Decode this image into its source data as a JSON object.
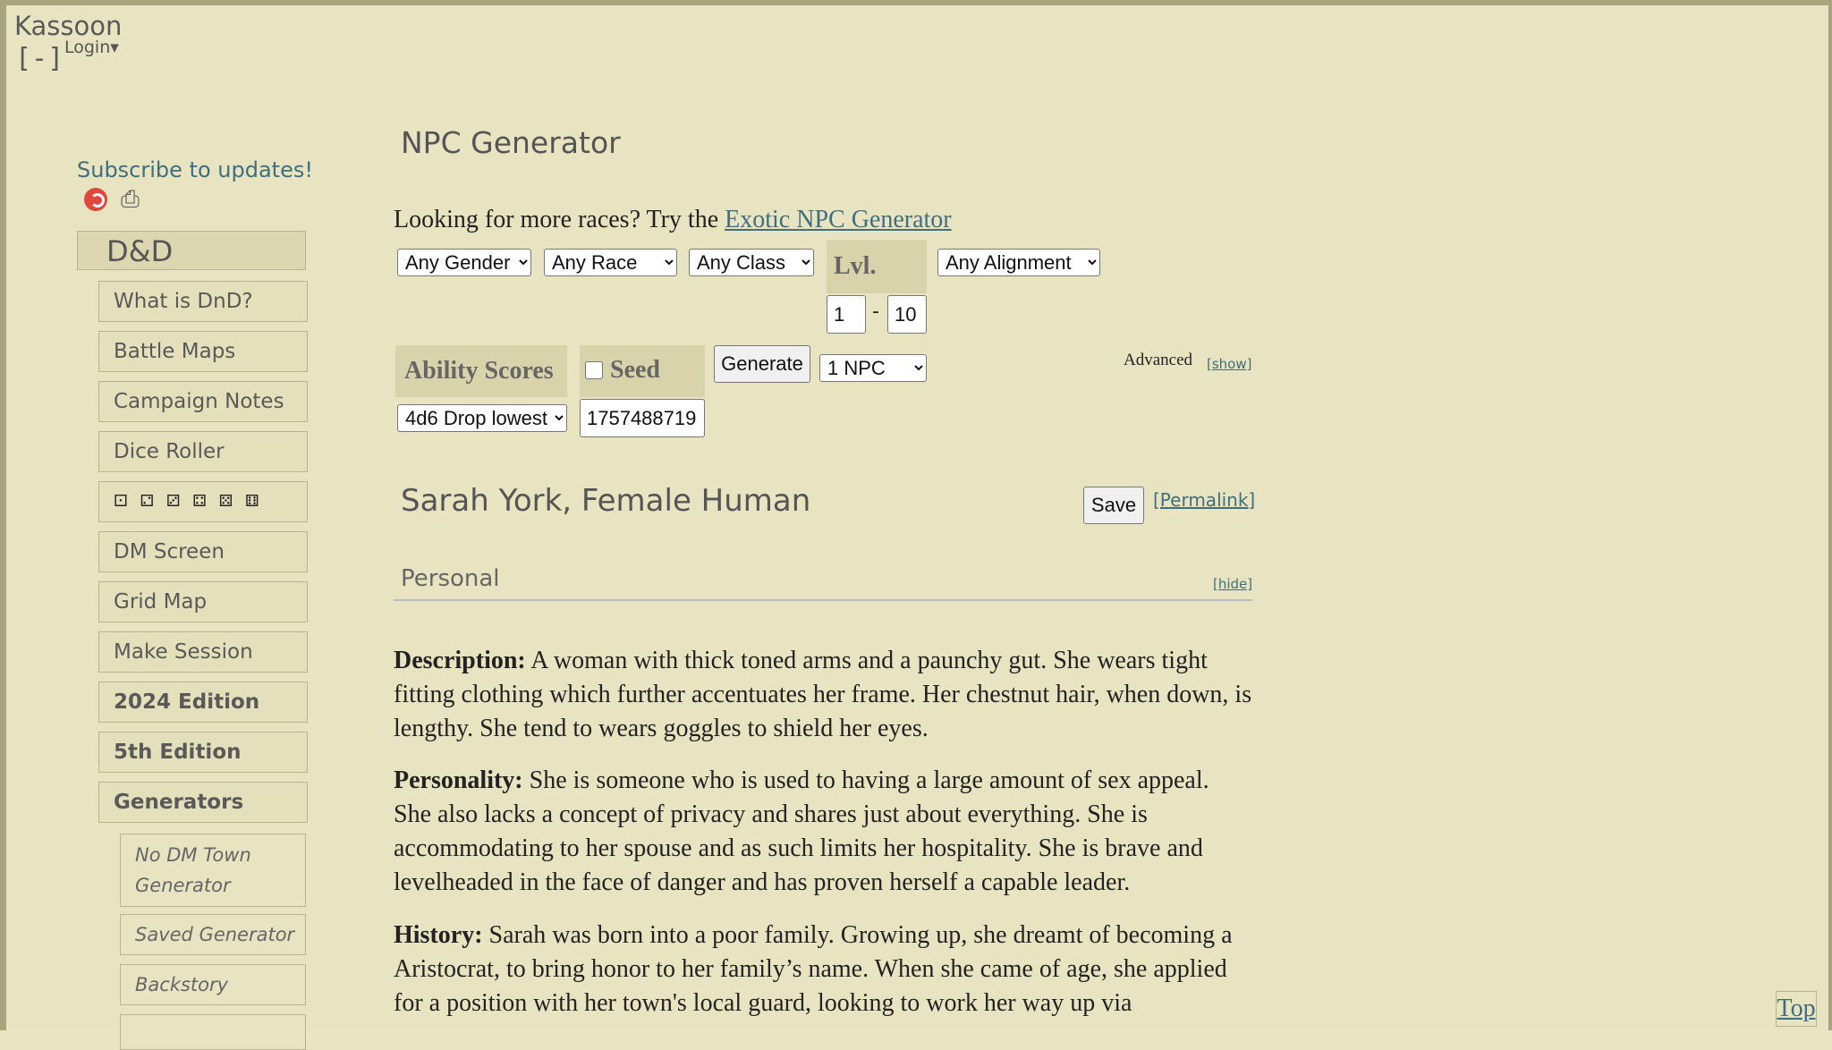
{
  "site": {
    "brand": "Kassoon",
    "collapse": "[-]",
    "login": "Login▾"
  },
  "sidebar": {
    "subscribe": "Subscribe to updates!",
    "head": "D&D",
    "items": [
      "What is DnD?",
      "Battle Maps",
      "Campaign Notes",
      "Dice Roller",
      "DM Screen",
      "Grid Map",
      "Make Session",
      "2024 Edition",
      "5th Edition",
      "Generators"
    ],
    "dice_glyphs": "⚀ ⚁ ⚂ ⚃ ⚄ ⚅",
    "sub_items": [
      "No DM Town Generator",
      "Saved Generator",
      "Backstory"
    ]
  },
  "main": {
    "title": "NPC Generator",
    "promo_text": "Looking for more races? Try the ",
    "promo_link": "Exotic NPC Generator",
    "filters": {
      "gender": "Any Gender",
      "race": "Any Race",
      "class": "Any Class",
      "level_label": "Lvl.",
      "level_min": "1",
      "level_sep": "-",
      "level_max": "10",
      "alignment": "Any Alignment"
    },
    "ability_label": "Ability Scores",
    "ability_method": "4d6 Drop lowest",
    "seed_label": "Seed",
    "seed_value": "1757488719",
    "generate": "Generate",
    "count": "1 NPC",
    "advanced": "Advanced",
    "show": "[show]",
    "npc_name": "Sarah York, Female Human",
    "save": "Save",
    "permalink": "[Permalink]",
    "section": "Personal",
    "hide": "[hide]",
    "description_label": "Description:",
    "description": " A woman with thick toned arms and a paunchy gut. She wears tight fitting clothing which further accentuates her frame. Her chestnut hair, when down, is lengthy. She tend to wears goggles to shield her eyes.",
    "personality_label": "Personality:",
    "personality": " She is someone who is used to having a large amount of sex appeal. She also lacks a concept of privacy and shares just about everything. She is accommodating to her spouse and as such limits her hospitality. She is brave and levelheaded in the face of danger and has proven herself a capable leader.",
    "history_label": "History:",
    "history": " Sarah was born into a poor family. Growing up, she dreamt of becoming a Aristocrat, to bring honor to her family’s name. When she came of age, she applied for a position with her town's local guard, looking to work her way up via"
  },
  "top_link": "Top",
  "colors": {
    "background": "#e9e4c2",
    "accent_link": "#3f6f7f",
    "frame": "#a9a47c"
  }
}
